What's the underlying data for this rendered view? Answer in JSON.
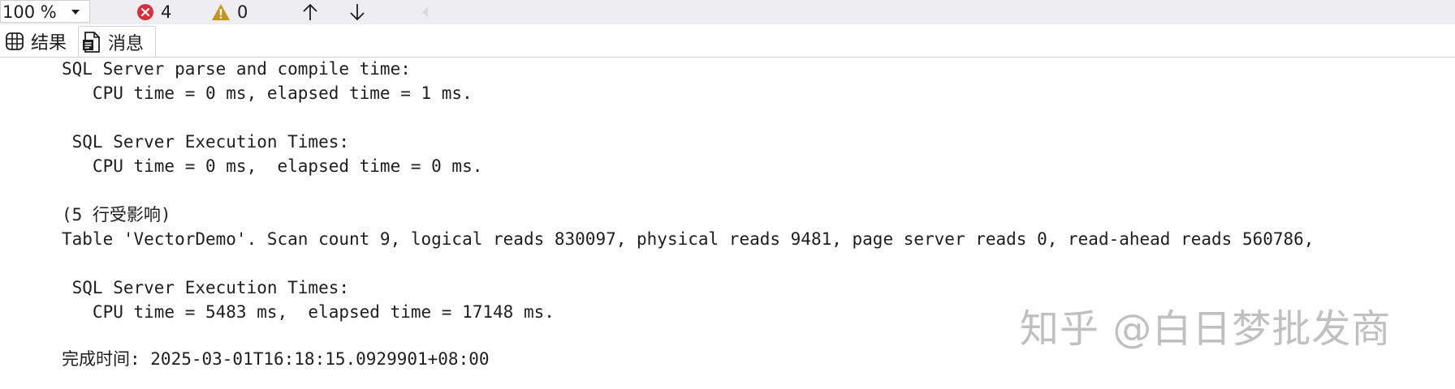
{
  "toolbar": {
    "zoom": "100 %",
    "errors": {
      "count": "4",
      "icon": "error-circle-icon",
      "color": "#d6313a"
    },
    "warnings": {
      "count": "0",
      "icon": "warning-triangle-icon",
      "color": "#c8951a"
    },
    "previous_icon": "arrow-up-icon",
    "next_icon": "arrow-down-icon",
    "scroll_icon": "scroll-left-icon"
  },
  "tabs": [
    {
      "label": "结果",
      "icon": "grid-icon",
      "active": false
    },
    {
      "label": "消息",
      "icon": "message-document-icon",
      "active": true
    }
  ],
  "messages": [
    "SQL Server parse and compile time:",
    "   CPU time = 0 ms, elapsed time = 1 ms.",
    " SQL Server Execution Times:",
    "   CPU time = 0 ms,  elapsed time = 0 ms.",
    "(5 行受影响)",
    "Table 'VectorDemo'. Scan count 9, logical reads 830097, physical reads 9481, page server reads 0, read-ahead reads 560786,",
    " SQL Server Execution Times:",
    "   CPU time = 5483 ms,  elapsed time = 17148 ms.",
    "完成时间: 2025-03-01T16:18:15.0929901+08:00"
  ],
  "watermark": "知乎 @白日梦批发商"
}
